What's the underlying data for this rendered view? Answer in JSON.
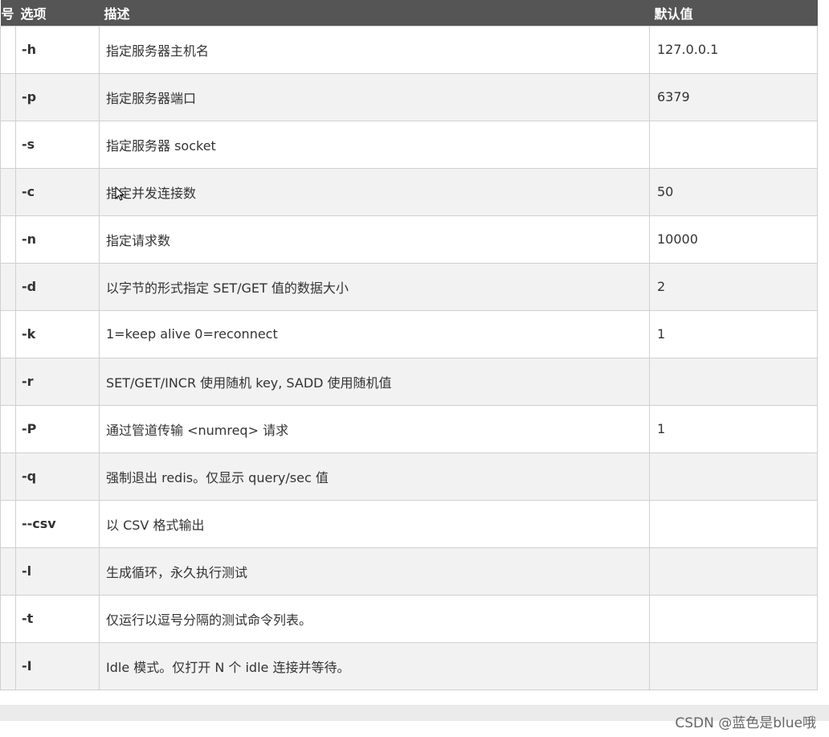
{
  "table": {
    "headers": {
      "num": "号",
      "option": "选项",
      "description": "描述",
      "default": "默认值"
    },
    "rows": [
      {
        "option": "-h",
        "description": "指定服务器主机名",
        "default": "127.0.0.1"
      },
      {
        "option": "-p",
        "description": "指定服务器端口",
        "default": "6379"
      },
      {
        "option": "-s",
        "description": "指定服务器 socket",
        "default": ""
      },
      {
        "option": "-c",
        "description": "指定并发连接数",
        "default": "50"
      },
      {
        "option": "-n",
        "description": "指定请求数",
        "default": "10000"
      },
      {
        "option": "-d",
        "description": "以字节的形式指定 SET/GET 值的数据大小",
        "default": "2"
      },
      {
        "option": "-k",
        "description": "1=keep alive 0=reconnect",
        "default": "1"
      },
      {
        "option": "-r",
        "description": "SET/GET/INCR 使用随机 key, SADD 使用随机值",
        "default": ""
      },
      {
        "option": "-P",
        "description": "通过管道传输 <numreq> 请求",
        "default": "1"
      },
      {
        "option": "-q",
        "description": "强制退出 redis。仅显示 query/sec 值",
        "default": ""
      },
      {
        "option": "--csv",
        "description": "以 CSV 格式输出",
        "default": ""
      },
      {
        "option": "-l",
        "description": "生成循环，永久执行测试",
        "default": ""
      },
      {
        "option": "-t",
        "description": "仅运行以逗号分隔的测试命令列表。",
        "default": ""
      },
      {
        "option": "-I",
        "description": "Idle 模式。仅打开 N 个 idle 连接并等待。",
        "default": ""
      }
    ]
  },
  "watermark": "CSDN @蓝色是blue哦",
  "colors": {
    "header_bg": "#555555",
    "header_text": "#ffffff",
    "row_alt_bg": "#f2f2f2",
    "border": "#d0d0d0"
  },
  "icons": {
    "cursor": "mouse-pointer-icon"
  }
}
